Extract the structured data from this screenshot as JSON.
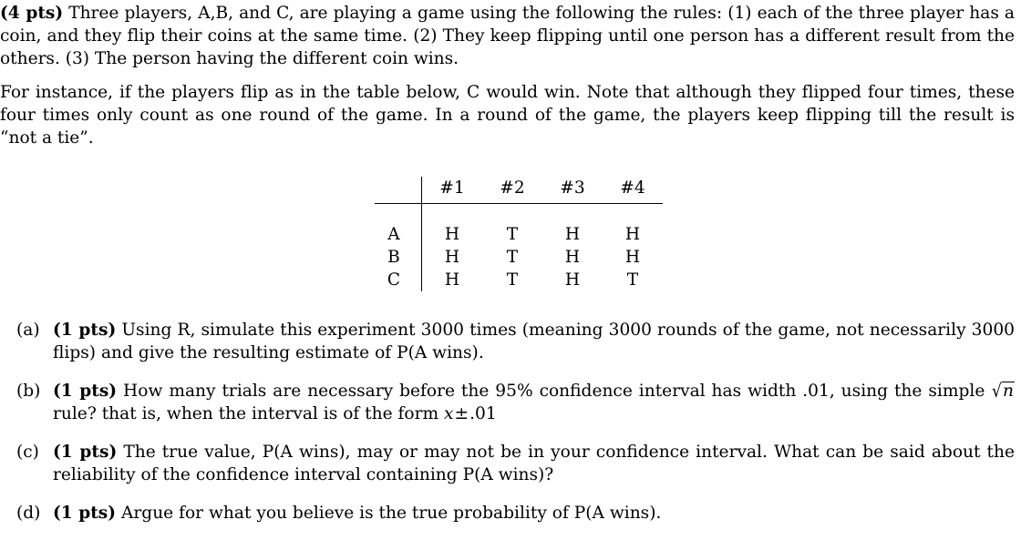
{
  "document": {
    "paragraphs": [
      {
        "id": "intro",
        "points_label": "(4 pts)",
        "text": " Three players, A,B, and C, are playing a game using the following the rules: (1) each of the three player has a coin, and they flip their coins at the same time. (2) They keep flipping until one person has a different result from the others. (3) The person having the different coin wins."
      },
      {
        "id": "instance",
        "text": "For instance, if the players flip as in the table below, C would win. Note that although they flipped four times, these four times only count as one round of the game. In a round of the game, the players keep flipping till the result is “not a tie”."
      }
    ],
    "table": {
      "corner_label": "",
      "columns": [
        "#1",
        "#2",
        "#3",
        "#4"
      ],
      "rows": [
        {
          "label": "A",
          "cells": [
            "H",
            "T",
            "H",
            "H"
          ]
        },
        {
          "label": "B",
          "cells": [
            "H",
            "T",
            "H",
            "H"
          ]
        },
        {
          "label": "C",
          "cells": [
            "H",
            "T",
            "H",
            "T"
          ]
        }
      ]
    },
    "items": [
      {
        "label": "(a)",
        "points_label": "(1 pts)",
        "text_before": " Using R, simulate this experiment 3000 times (meaning 3000 rounds of the game, not necessarily 3000 flips) and give the resulting estimate of P(A wins)."
      },
      {
        "label": "(b)",
        "points_label": "(1 pts)",
        "text_part1": " How many trials are necessary before the 95% confidence interval has width .01, using the simple ",
        "math_sqrt_radicand": "n",
        "text_part2": " rule? that is, when the interval is of the form ",
        "math_var": "x",
        "math_pm": "±",
        "math_value": ".01"
      },
      {
        "label": "(c)",
        "points_label": "(1 pts)",
        "text_before": " The true value, P(A wins), may or may not be in your confidence interval. What can be said about the reliability of the confidence interval containing P(A wins)?"
      },
      {
        "label": "(d)",
        "points_label": "(1 pts)",
        "text_before": " Argue for what you believe is the true probability of P(A wins)."
      }
    ]
  }
}
